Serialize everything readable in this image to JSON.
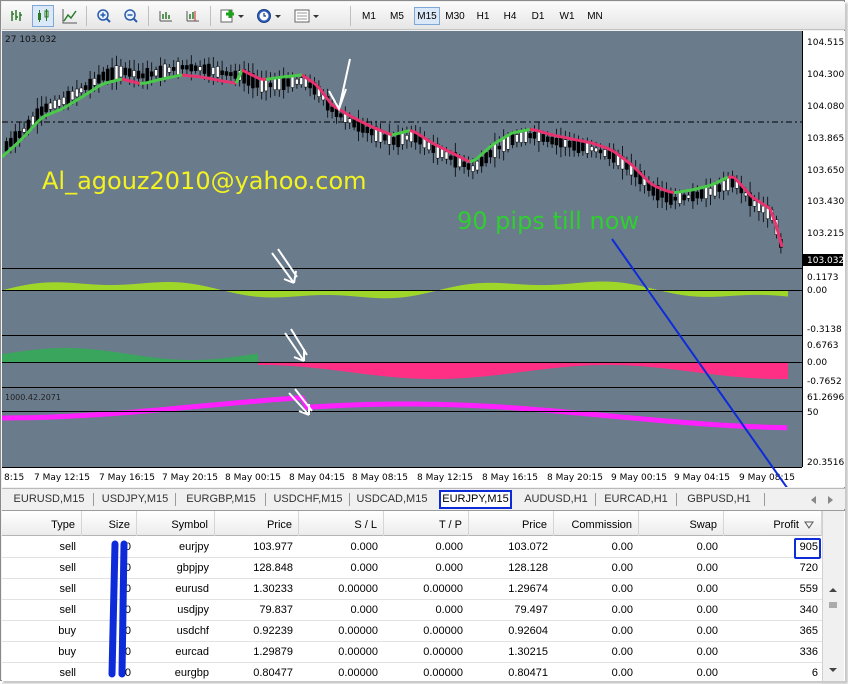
{
  "toolbar": {
    "timeframes": [
      "M1",
      "M5",
      "M15",
      "M30",
      "H1",
      "H4",
      "D1",
      "W1",
      "MN"
    ],
    "active_timeframe": "M15"
  },
  "chart": {
    "top_label": "27 103.032",
    "current_price": "103.032",
    "price_scale": [
      "104.515",
      "104.300",
      "104.080",
      "103.865",
      "103.650",
      "103.430",
      "103.215"
    ],
    "ind1_scale": [
      "0.1173",
      "0.00",
      "-0.3138"
    ],
    "ind2_scale": [
      "0.6763",
      "0.00",
      "-0.7652"
    ],
    "ind3_label": "1000.42.2071",
    "ind3_scale": [
      "61.2696",
      "50",
      "20.3516"
    ],
    "time_labels": [
      "8:15",
      "7 May 12:15",
      "7 May 16:15",
      "7 May 20:15",
      "8 May 00:15",
      "8 May 04:15",
      "8 May 08:15",
      "8 May 12:15",
      "8 May 16:15",
      "8 May 20:15",
      "9 May 00:15",
      "9 May 04:15",
      "9 May 08:15"
    ],
    "annotation_email": "Al_agouz2010@yahoo.com",
    "annotation_pips": "90 pips till now",
    "colors": {
      "background": "#6a7b8c",
      "up_candle": "#ffffff",
      "down_candle": "#000000",
      "ma_up": "#4ac94a",
      "ma_down": "#e8336f",
      "osc1": "#9fd62a",
      "osc2_green": "#3aa55d",
      "osc2_pink": "#ff2f86",
      "line3": "#ff1fff",
      "annotation_yellow": "#f3f321",
      "annotation_green": "#2fcf2f",
      "marker_blue": "#0d2bd8"
    }
  },
  "tabs": {
    "items": [
      "EURUSD,M15",
      "USDJPY,M15",
      "EURGBP,M15",
      "USDCHF,M15",
      "USDCAD,M15",
      "EURJPY,M15",
      "AUDUSD,H1",
      "EURCAD,H1",
      "GBPUSD,H1"
    ],
    "active": "EURJPY,M15"
  },
  "table": {
    "headers": [
      "Type",
      "Size",
      "Symbol",
      "Price",
      "S / L",
      "T / P",
      "Price",
      "Commission",
      "Swap",
      "Profit"
    ],
    "rows": [
      {
        "type": "sell",
        "size": "0",
        "symbol": "eurjpy",
        "price": "103.977",
        "sl": "0.000",
        "tp": "0.000",
        "cur": "103.072",
        "commission": "0.00",
        "swap": "0.00",
        "profit": "905"
      },
      {
        "type": "sell",
        "size": "0",
        "symbol": "gbpjpy",
        "price": "128.848",
        "sl": "0.000",
        "tp": "0.000",
        "cur": "128.128",
        "commission": "0.00",
        "swap": "0.00",
        "profit": "720"
      },
      {
        "type": "sell",
        "size": "0",
        "symbol": "eurusd",
        "price": "1.30233",
        "sl": "0.00000",
        "tp": "0.00000",
        "cur": "1.29674",
        "commission": "0.00",
        "swap": "0.00",
        "profit": "559"
      },
      {
        "type": "sell",
        "size": "0",
        "symbol": "usdjpy",
        "price": "79.837",
        "sl": "0.000",
        "tp": "0.000",
        "cur": "79.497",
        "commission": "0.00",
        "swap": "0.00",
        "profit": "340"
      },
      {
        "type": "buy",
        "size": "0",
        "symbol": "usdchf",
        "price": "0.92239",
        "sl": "0.00000",
        "tp": "0.00000",
        "cur": "0.92604",
        "commission": "0.00",
        "swap": "0.00",
        "profit": "365"
      },
      {
        "type": "buy",
        "size": "0",
        "symbol": "eurcad",
        "price": "1.29879",
        "sl": "0.00000",
        "tp": "0.00000",
        "cur": "1.30215",
        "commission": "0.00",
        "swap": "0.00",
        "profit": "336"
      },
      {
        "type": "sell",
        "size": "0",
        "symbol": "eurgbp",
        "price": "0.80477",
        "sl": "0.00000",
        "tp": "0.00000",
        "cur": "0.80471",
        "commission": "0.00",
        "swap": "0.00",
        "profit": "6"
      }
    ]
  }
}
